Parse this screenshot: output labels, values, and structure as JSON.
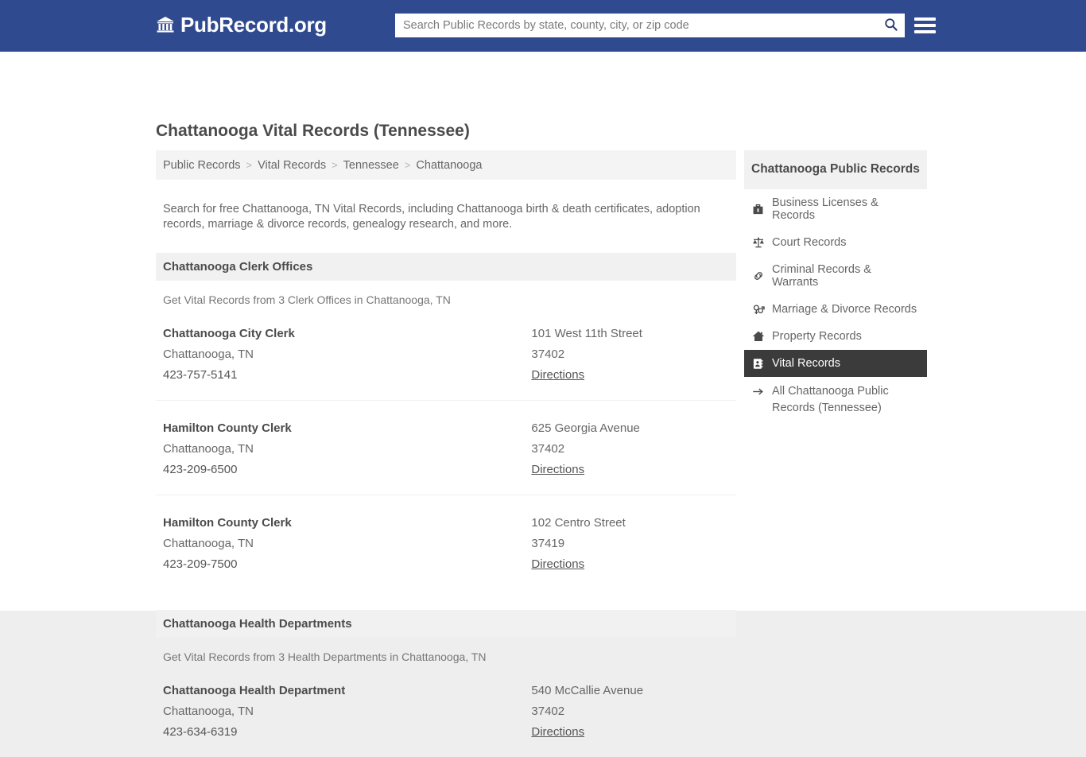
{
  "header": {
    "logo_text": "PubRecord.org",
    "logo_icon": "university-icon",
    "search": {
      "placeholder": "Search Public Records by state, county, city, or zip code",
      "value": "",
      "icon": "search-icon"
    },
    "menu_icon": "hamburger-menu-icon",
    "brand_color": "#2f4a8e"
  },
  "page": {
    "title": "Chattanooga Vital Records (Tennessee)",
    "intro": "Search for free Chattanooga, TN Vital Records, including Chattanooga birth & death certificates, adoption records, marriage & divorce records, genealogy research, and more."
  },
  "breadcrumb": {
    "separator": ">",
    "items": [
      {
        "label": "Public Records"
      },
      {
        "label": "Vital Records"
      },
      {
        "label": "Tennessee"
      },
      {
        "label": "Chattanooga"
      }
    ]
  },
  "sections": [
    {
      "heading": "Chattanooga Clerk Offices",
      "subheading": "Get Vital Records from 3 Clerk Offices in Chattanooga, TN",
      "listings": [
        {
          "name": "Chattanooga City Clerk",
          "city": "Chattanooga, TN",
          "phone": "423-757-5141",
          "address": "101 West 11th Street",
          "zip": "37402",
          "directions": "Directions"
        },
        {
          "name": "Hamilton County Clerk",
          "city": "Chattanooga, TN",
          "phone": "423-209-6500",
          "address": "625 Georgia Avenue",
          "zip": "37402",
          "directions": "Directions"
        },
        {
          "name": "Hamilton County Clerk",
          "city": "Chattanooga, TN",
          "phone": "423-209-7500",
          "address": "102 Centro Street",
          "zip": "37419",
          "directions": "Directions"
        }
      ]
    },
    {
      "heading": "Chattanooga Health Departments",
      "subheading": "Get Vital Records from 3 Health Departments in Chattanooga, TN",
      "listings": [
        {
          "name": "Chattanooga Health Department",
          "city": "Chattanooga, TN",
          "phone": "423-634-6319",
          "address": "540 McCallie Avenue",
          "zip": "37402",
          "directions": "Directions"
        }
      ]
    }
  ],
  "sidebar": {
    "heading": "Chattanooga Public Records",
    "active_bg": "#3b3b3b",
    "items": [
      {
        "label": "Business Licenses & Records",
        "icon": "briefcase-icon",
        "active": false
      },
      {
        "label": "Court Records",
        "icon": "balance-scale-icon",
        "active": false
      },
      {
        "label": "Criminal Records & Warrants",
        "icon": "link-chain-icon",
        "active": false
      },
      {
        "label": "Marriage & Divorce Records",
        "icon": "venus-mars-icon",
        "active": false
      },
      {
        "label": "Property Records",
        "icon": "home-icon",
        "active": false
      },
      {
        "label": "Vital Records",
        "icon": "address-card-icon",
        "active": true
      }
    ],
    "all_link": {
      "label": "All Chattanooga Public Records (Tennessee)",
      "icon": "arrow-right-icon"
    }
  }
}
